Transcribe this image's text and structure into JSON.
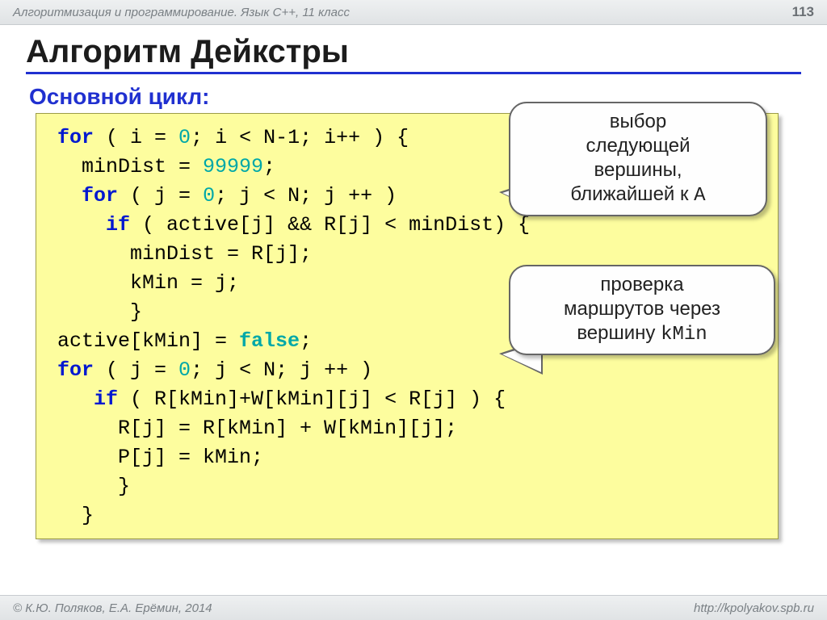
{
  "header": {
    "course": "Алгоритмизация и программирование. Язык C++, 11 класс",
    "page_number": "113"
  },
  "title": "Алгоритм Дейкстры",
  "subtitle": "Основной цикл:",
  "code": {
    "l1_for": "for",
    "l1_a": " ( i = ",
    "l1_zero": "0",
    "l1_b": "; i < N-1; i++ ) {",
    "l2_a": "  minDist = ",
    "l2_num": "99999",
    "l2_b": ";",
    "l3_for": "for",
    "l3_a": "  ",
    "l3_b": " ( j = ",
    "l3_zero": "0",
    "l3_c": "; j < N; j ++ )",
    "l4_if": "if",
    "l4_a": "    ",
    "l4_b": " ( active[j] && R[j] < minDist) {",
    "l5": "      minDist = R[j];",
    "l6": "      kMin = j;",
    "l7": "      }",
    "l8_a": "active[kMin] = ",
    "l8_false": "false",
    "l8_b": ";",
    "l9_for": "for",
    "l9_a": " ( j = ",
    "l9_zero": "0",
    "l9_b": "; j < N; j ++ )",
    "l10_if": "if",
    "l10_a": "   ",
    "l10_b": " ( R[kMin]+W[kMin][j] < R[j] ) {",
    "l11": "     R[j] = R[kMin] + W[kMin][j];",
    "l12": "     P[j] = kMin;",
    "l13": "     }",
    "l14": "  }"
  },
  "callouts": {
    "c1_l1": "выбор",
    "c1_l2": "следующей",
    "c1_l3": "вершины,",
    "c1_l4a": "ближайшей к ",
    "c1_l4b": "A",
    "c2_l1": "проверка",
    "c2_l2": "маршрутов через",
    "c2_l3a": "вершину ",
    "c2_l3b": "kMin"
  },
  "footer": {
    "copyright": "© К.Ю. Поляков, Е.А. Ерёмин, 2014",
    "url": "http://kpolyakov.spb.ru"
  }
}
